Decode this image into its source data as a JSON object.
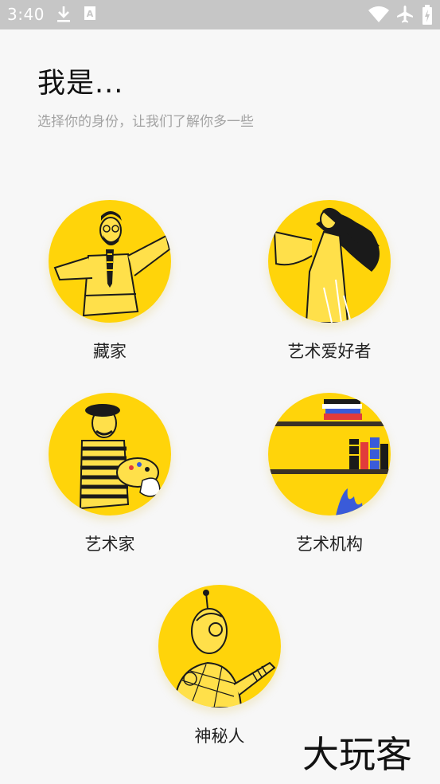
{
  "status_bar": {
    "time": "3:40",
    "icons": [
      "download-icon",
      "keyboard-a-icon",
      "wifi-icon",
      "airplane-mode-icon",
      "battery-charging-icon"
    ]
  },
  "page": {
    "title": "我是...",
    "subtitle": "选择你的身份，让我们了解你多一些"
  },
  "identities": [
    {
      "label": "藏家",
      "illustration": "collector-icon"
    },
    {
      "label": "艺术爱好者",
      "illustration": "art-lover-icon"
    },
    {
      "label": "艺术家",
      "illustration": "artist-icon"
    },
    {
      "label": "艺术机构",
      "illustration": "art-institution-icon"
    },
    {
      "label": "神秘人",
      "illustration": "mystery-person-icon"
    }
  ],
  "watermark": {
    "text": "大玩客"
  },
  "colors": {
    "accent": "#ffd40a",
    "background": "#f7f7f7",
    "status_bar": "#c6c6c6"
  }
}
